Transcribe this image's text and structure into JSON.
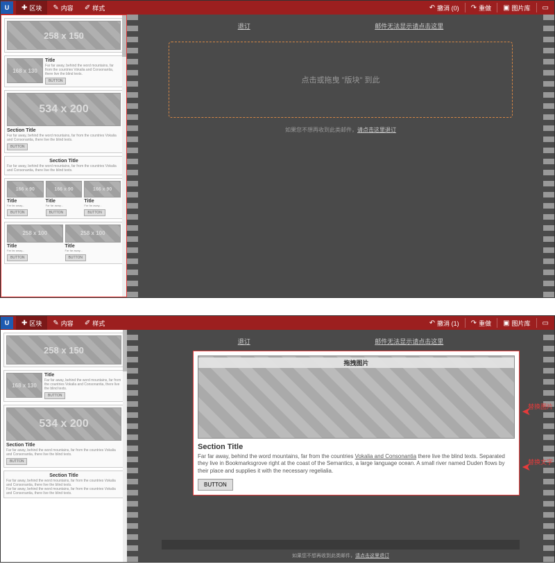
{
  "toolbar": {
    "logo": "U",
    "blocks": "区块",
    "content": "内容",
    "style": "样式",
    "undo1": "撤消 (0)",
    "undo2": "撤消 (1)",
    "redo": "重做",
    "imglib": "图片库"
  },
  "nav": {
    "unsub": "退订",
    "viewonline": "邮件无法显示请点击这里"
  },
  "dropzone": "点击或拖曳 \"版块\" 到此",
  "footer": {
    "pre": "如果您不想再收到此类邮件，",
    "link": "请点击这里退订"
  },
  "sidebar": {
    "ph1": "258 x 150",
    "ph2": "168 x 130",
    "ph3": "534 x 200",
    "ph4": "166 x 90",
    "ph5": "258 x 100",
    "title": "Title",
    "section": "Section Title",
    "button": "BUTTON",
    "lorem": "Far far away, behind the word mountains, far from the countries Vokalia and Consonantia, there live the blind texts."
  },
  "selected": {
    "imglabel": "拖拽图片",
    "st": "Section Title",
    "text_a": "Far far away, behind the word mountains, far from the countries ",
    "text_u": "Vokalia and Consonantia",
    "text_b": " there live the blind texts. Separated they live in Bookmarksgrove right at the coast of the Semantics, a large language ocean. A small river named Duden flows by their place and supplies it with the necessary regelialia.",
    "btn": "BUTTON"
  },
  "anno": {
    "img": "替换图片",
    "text": "替换文字"
  }
}
